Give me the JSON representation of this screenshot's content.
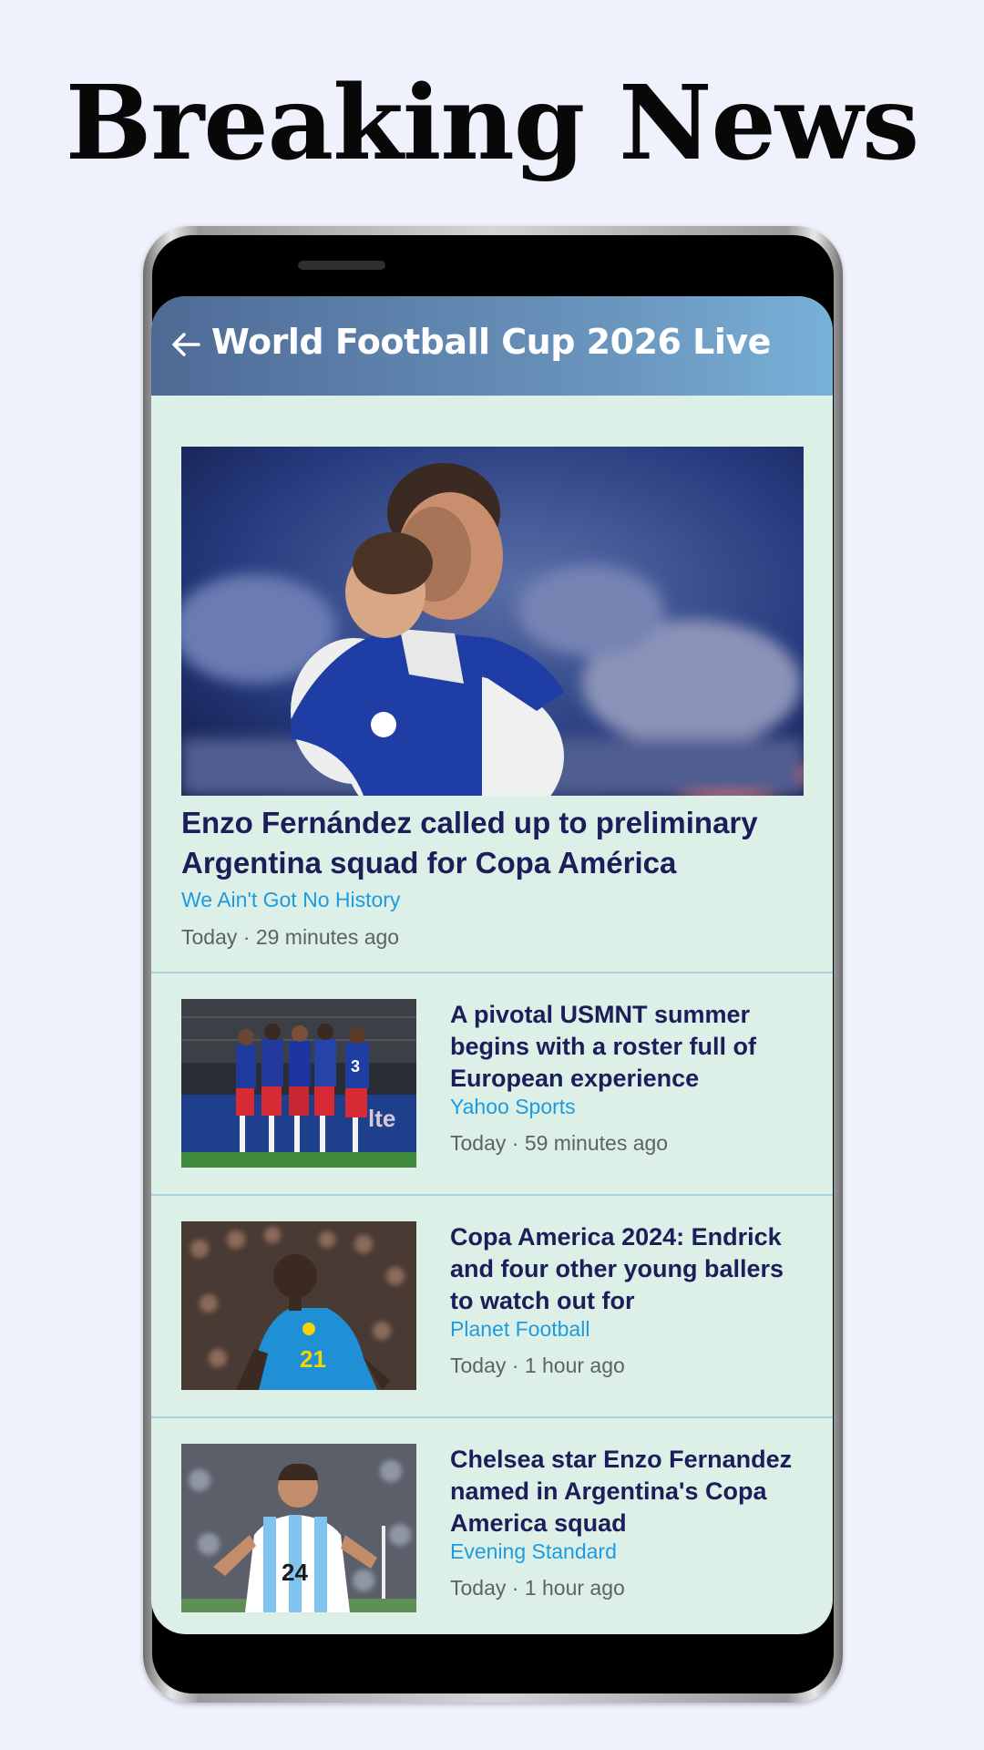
{
  "promo": {
    "title": "Breaking News"
  },
  "app": {
    "title": "World Football Cup 2026 Live",
    "back_icon": "arrow-left-icon",
    "colors": {
      "header_start": "#4e6a95",
      "header_end": "#78b1d8",
      "background": "#dcf0e8",
      "headline": "#1a1f5a",
      "source": "#1e9be0",
      "time": "#5e6168"
    }
  },
  "articles": [
    {
      "headline": "Enzo Fernández called up to preliminary Argentina squad for Copa América",
      "source": "We Ain't Got No History",
      "time": "Today · 29 minutes ago"
    },
    {
      "headline": "A pivotal USMNT summer begins with a roster full of European experience",
      "source": "Yahoo Sports",
      "time": "Today · 59 minutes ago"
    },
    {
      "headline": "Copa America 2024: Endrick and four other young ballers to watch out for",
      "source": "Planet Football",
      "time": "Today · 1 hour ago"
    },
    {
      "headline": "Chelsea star Enzo Fernandez named in Argentina's Copa America squad",
      "source": "Evening Standard",
      "time": "Today · 1 hour ago"
    }
  ]
}
